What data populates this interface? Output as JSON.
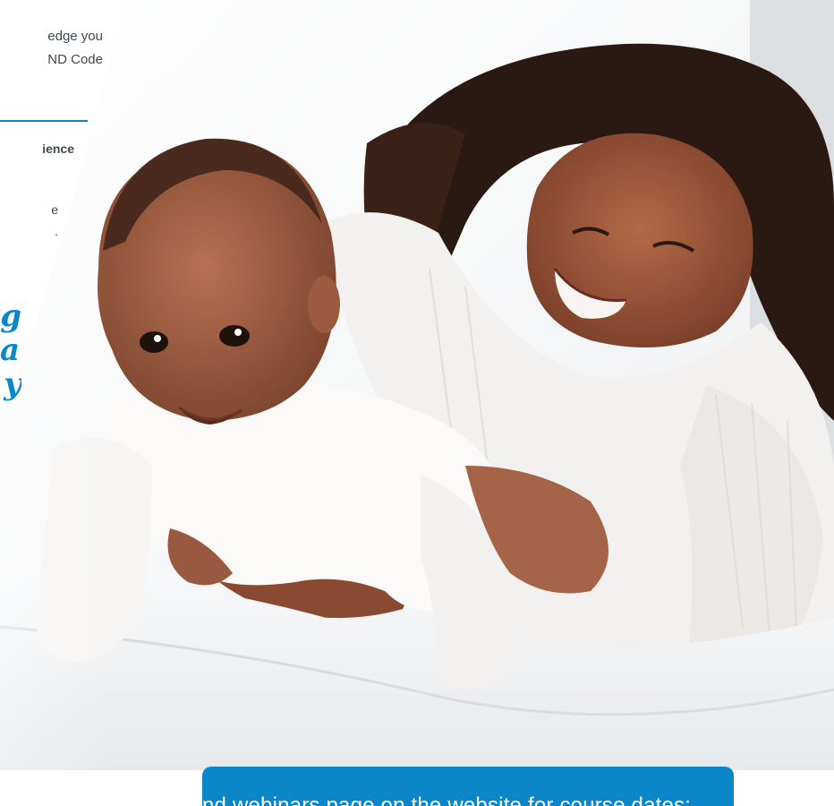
{
  "intro": {
    "line1": "edge you",
    "line2": "ND Code"
  },
  "sidebar_label": "ience",
  "small_text": {
    "line1": "e",
    "line2": "."
  },
  "quote": {
    "line1": "g",
    "line2": "at",
    "line3": "y"
  },
  "hero": {
    "image": "mother-and-baby-photo"
  },
  "banner": {
    "text": "nd webinars page on the website for course dates:"
  },
  "colors": {
    "accent": "#0a86c9",
    "text": "#3f4752",
    "background": "#ffffff"
  }
}
